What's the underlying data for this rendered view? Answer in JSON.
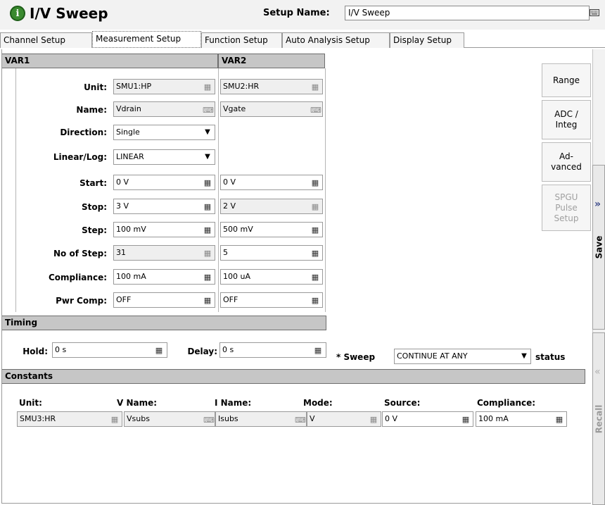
{
  "header": {
    "title": "I/V Sweep",
    "setup_name_label": "Setup Name:",
    "setup_name_value": "I/V Sweep"
  },
  "tabs": [
    {
      "label": "Channel Setup",
      "active": false
    },
    {
      "label": "Measurement Setup",
      "active": true
    },
    {
      "label": "Function Setup",
      "active": false
    },
    {
      "label": "Auto Analysis Setup",
      "active": false
    },
    {
      "label": "Display Setup",
      "active": false
    }
  ],
  "var1": {
    "header": "VAR1",
    "unit_label": "Unit:",
    "unit": "SMU1:HP",
    "name_label": "Name:",
    "name": "Vdrain",
    "direction_label": "Direction:",
    "direction": "Single",
    "linlog_label": "Linear/Log:",
    "linlog": "LINEAR",
    "start_label": "Start:",
    "start": "0 V",
    "stop_label": "Stop:",
    "stop": "3 V",
    "step_label": "Step:",
    "step": "100 mV",
    "nstep_label": "No of Step:",
    "nstep": "31",
    "compliance_label": "Compliance:",
    "compliance": "100 mA",
    "pwrcomp_label": "Pwr Comp:",
    "pwrcomp": "OFF"
  },
  "var2": {
    "header": "VAR2",
    "unit": "SMU2:HR",
    "name": "Vgate",
    "start": "0 V",
    "stop": "2 V",
    "step": "500 mV",
    "nstep": "5",
    "compliance": "100 uA",
    "pwrcomp": "OFF"
  },
  "side_buttons": {
    "range": "Range",
    "adc": "ADC /\nInteg",
    "advanced": "Ad-\nvanced",
    "spgu": "SPGU\nPulse\nSetup"
  },
  "timing": {
    "header": "Timing",
    "hold_label": "Hold:",
    "hold": "0 s",
    "delay_label": "Delay:",
    "delay": "0 s",
    "sweep_label": "* Sweep",
    "sweep_value": "CONTINUE AT ANY",
    "status_label": "status"
  },
  "constants": {
    "header": "Constants",
    "col_unit": "Unit:",
    "col_vname": "V Name:",
    "col_iname": "I Name:",
    "col_mode": "Mode:",
    "col_source": "Source:",
    "col_compliance": "Compliance:",
    "row": {
      "unit": "SMU3:HR",
      "vname": "Vsubs",
      "iname": "Isubs",
      "mode": "V",
      "source": "0 V",
      "compliance": "100 mA"
    }
  },
  "rail": {
    "save": "Save",
    "recall": "Recall"
  }
}
